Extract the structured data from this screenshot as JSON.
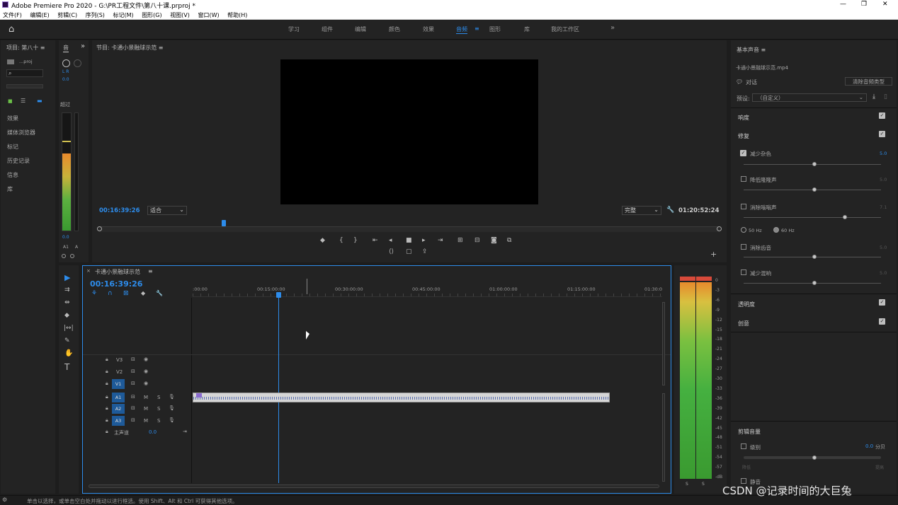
{
  "window": {
    "title": "Adobe Premiere Pro 2020 - G:\\PR工程文件\\第八十课.prproj *",
    "controls": [
      "—",
      "❐",
      "✕"
    ]
  },
  "menu": [
    "文件(F)",
    "编辑(E)",
    "剪辑(C)",
    "序列(S)",
    "标记(M)",
    "图形(G)",
    "视图(V)",
    "窗口(W)",
    "帮助(H)"
  ],
  "workspaces": [
    "学习",
    "组件",
    "编辑",
    "颜色",
    "效果",
    "音频",
    "图形",
    "库",
    "我的工作区"
  ],
  "active_workspace": "音频",
  "project": {
    "title": "项目: 第八十 ≡",
    "file": "...proj",
    "items": [
      "效果",
      "媒体浏览器",
      "标记",
      "历史记录",
      "信息",
      "库"
    ]
  },
  "audio_mixer": {
    "lr": "L R",
    "val": "0.0",
    "label": "超过",
    "bottom_val": "0.0",
    "ch": [
      "A1",
      "A"
    ]
  },
  "program": {
    "title": "节目: 卡通小景融球示范 ≡",
    "timecode": "00:16:39:26",
    "fit": "适合",
    "quality": "完整",
    "duration": "01:20:52:24"
  },
  "timeline": {
    "title": "卡通小景融球示范",
    "timecode": "00:16:39:26",
    "ruler": [
      ":00:00",
      "00:15:00:00",
      "00:30:00:00",
      "00:45:00:00",
      "01:00:00:00",
      "01:15:00:00",
      "01:30:0"
    ],
    "tracks": [
      {
        "name": "V3"
      },
      {
        "name": "V2"
      },
      {
        "name": "V1"
      },
      {
        "name": "A1"
      },
      {
        "name": "A2"
      },
      {
        "name": "A3"
      }
    ],
    "master": {
      "label": "主声道",
      "val": "0.0"
    },
    "m": "M",
    "s": "S"
  },
  "meter": {
    "scale": [
      "0",
      "-3",
      "-6",
      "-9",
      "-12",
      "-15",
      "-18",
      "-21",
      "-24",
      "-27",
      "-30",
      "-33",
      "-36",
      "-39",
      "-42",
      "-45",
      "-48",
      "-51",
      "-54",
      "-57",
      "-dB"
    ],
    "solo": [
      "S",
      "S"
    ]
  },
  "essential_sound": {
    "title": "基本声音 ≡",
    "file": "卡通小景融球示范.mp4",
    "type": "对话",
    "clear": "清除音频类型",
    "preset_label": "预设:",
    "preset": "（自定义）",
    "loudness": "响度",
    "repair": "修复",
    "reduce_noise": {
      "label": "减少杂色",
      "val": "5.0"
    },
    "reduce_rumble": {
      "label": "降低隆隆声",
      "val": "5.0"
    },
    "dehum": {
      "label": "消除嗡嗡声",
      "val": "7.1"
    },
    "hz50": "50 Hz",
    "hz60": "60 Hz",
    "deess": {
      "label": "消除齿音",
      "val": "5.0"
    },
    "reduce_reverb": {
      "label": "减少混响",
      "val": "5.0"
    },
    "clarity": "透明度",
    "creative": "创意",
    "clip_volume": "剪辑音量",
    "level": {
      "label": "级别",
      "val": "0.0",
      "unit": "分贝"
    },
    "lower": "降低",
    "raise": "提高",
    "mute": "静音"
  },
  "status": "单击以选择，或单击空白处并拖动以进行框选。使用 Shift、Alt 和 Ctrl 可获得其他选项。",
  "watermark": "CSDN @记录时间的大巨兔"
}
